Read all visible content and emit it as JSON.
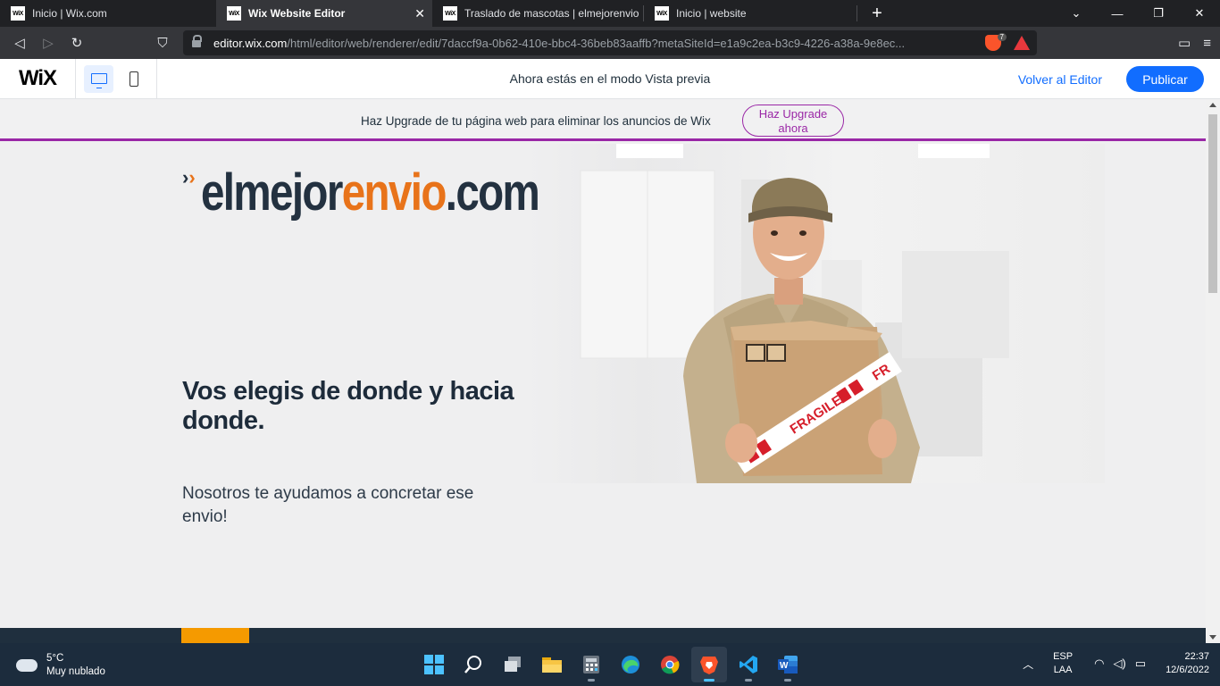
{
  "browser": {
    "tabs": [
      {
        "label": "Inicio | Wix.com",
        "favicon": "WiX"
      },
      {
        "label": "Wix Website Editor",
        "favicon": "WiX",
        "active": true
      },
      {
        "label": "Traslado de mascotas | elmejorenvio",
        "favicon": "WiX"
      },
      {
        "label": "Inicio | website",
        "favicon": "WiX"
      }
    ],
    "url_host": "editor.wix.com",
    "url_path": "/html/editor/web/renderer/edit/7daccf9a-0b62-410e-bbc4-36beb83aaffb?metaSiteId=e1a9c2ea-b3c9-4226-a38a-9e8ec...",
    "extension_badge": "7",
    "window_controls": {
      "minimize": "—",
      "maximize": "❐",
      "close": "✕"
    }
  },
  "wix_bar": {
    "logo": "WiX",
    "preview_message": "Ahora estás en el modo Vista previa",
    "back_to_editor": "Volver al Editor",
    "publish": "Publicar"
  },
  "site": {
    "upgrade_banner": {
      "text": "Haz Upgrade de tu página web para eliminar los anuncios de Wix",
      "button": "Haz Upgrade ahora"
    },
    "logo": {
      "part1": "elmejor",
      "part2": "envio",
      "part3": ".com"
    },
    "headline": "Vos elegis de donde y hacia donde.",
    "subtext": "Nosotros te ayudamos a concretar ese envio!",
    "box_label": "FRAGILE",
    "box_label_cut": "FR"
  },
  "taskbar": {
    "weather_temp": "5°C",
    "weather_desc": "Muy nublado",
    "lang_1": "ESP",
    "lang_2": "LAA",
    "time": "22:37",
    "date": "12/6/2022"
  },
  "colors": {
    "brand_navy": "#233140",
    "brand_orange": "#e8731a",
    "wix_blue": "#116dff",
    "upgrade_purple": "#9a27a6"
  }
}
